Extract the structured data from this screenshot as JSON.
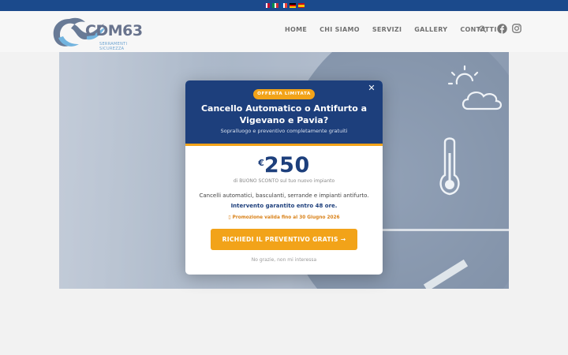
{
  "colors": {
    "brand_blue": "#1d3f7c",
    "accent_orange": "#f2a319",
    "topbar": "#1b4a8c"
  },
  "language_flags": [
    "flag-english",
    "flag-italian",
    "flag-french",
    "flag-german",
    "flag-spanish"
  ],
  "logo": {
    "text": "CDM63",
    "tagline": "SERRAMENTI SICUREZZA"
  },
  "nav": {
    "items": [
      "HOME",
      "CHI SIAMO",
      "SERVIZI",
      "GALLERY",
      "CONTATTI"
    ],
    "icons": [
      "search-icon",
      "facebook-icon",
      "instagram-icon"
    ]
  },
  "popup": {
    "badge": "OFFERTA LIMITATA",
    "title_line1": "Cancello Automatico o Antifurto a",
    "title_line2": "Vigevano e Pavia?",
    "subtitle": "Sopralluogo e preventivo completamente gratuiti",
    "price_currency": "€",
    "price_value": "250",
    "price_note": "di BUONO SCONTO sul tuo nuovo impianto",
    "description": "Cancelli automatici, basculanti, serrande e impianti antifurto.",
    "guarantee": "Intervento garantito entro 48 ore.",
    "promo": "▯ Promozione valida fino al 30 Giugno 2026",
    "cta": "RICHIEDI IL PREVENTIVO GRATIS →",
    "decline": "No grazie, non mi interessa",
    "close_icon": "close-icon"
  }
}
